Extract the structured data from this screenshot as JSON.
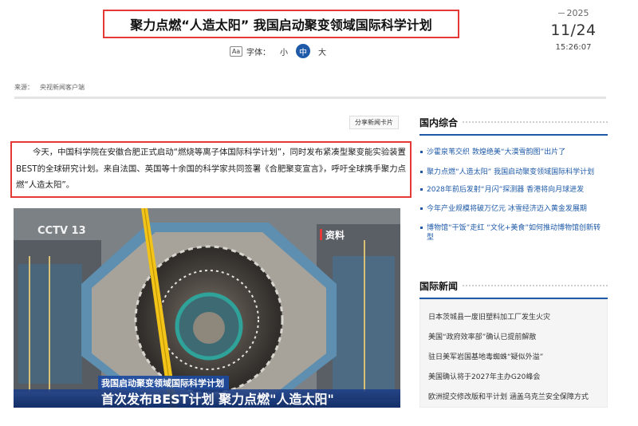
{
  "article": {
    "title": "聚力点燃“人造太阳” 我国启动聚变领域国际科学计划",
    "date": {
      "year": "2025",
      "day": "11/24",
      "time": "15:26:07"
    },
    "font_size": {
      "icon_text": "Aa",
      "label": "字体：",
      "options": [
        "小",
        "中",
        "大"
      ],
      "selected": "中"
    },
    "source_label": "来源：",
    "source_value": "央视新闻客户端",
    "share_card_label": "分享新闻卡片",
    "lead": "今天，中国科学院在安徽合肥正式启动“燃烧等离子体国际科学计划”，同时发布紧凑型聚变能实验装置BEST的全球研究计划。来自法国、英国等十余国的科学家共同签署《合肥聚变宣言》，呼吁全球携手聚力点燃“人造太阳”。",
    "image": {
      "logo": "CCTV 13",
      "tag": "资料",
      "caption_small": "我国启动聚变领域国际科学计划",
      "caption_big": "首次发布BEST计划 聚力点燃\"人造太阳\""
    }
  },
  "sidebar": {
    "domestic": {
      "title": "国内综合",
      "items": [
        "沙霍泉苇交织 敦煌绝美“大漠雪韵图”出片了",
        "聚力点燃“人造太阳” 我国启动聚变领域国际科学计划",
        "2028年前后发射“月闪”探测器 香港将向月球进发",
        "今年产业规模将破万亿元 冰雪经济迈入黄金发展期",
        "博物馆“干饭”走红 “文化+美食”如何推动博物馆创新转型"
      ]
    },
    "international": {
      "title": "国际新闻",
      "items": [
        "日本茨城县一废旧塑料加工厂发生火灾",
        "美国“政府效率部”确认已提前解散",
        "驻日美军岩国基地毒蜘蛛“疑似外溢”",
        "美国确认将于2027年主办G20峰会",
        "欧洲提交修改版和平计划 涵盖乌克兰安全保障方式"
      ]
    }
  },
  "colors": {
    "accent_blue": "#1e5aa8",
    "highlight_red": "#e53935"
  }
}
